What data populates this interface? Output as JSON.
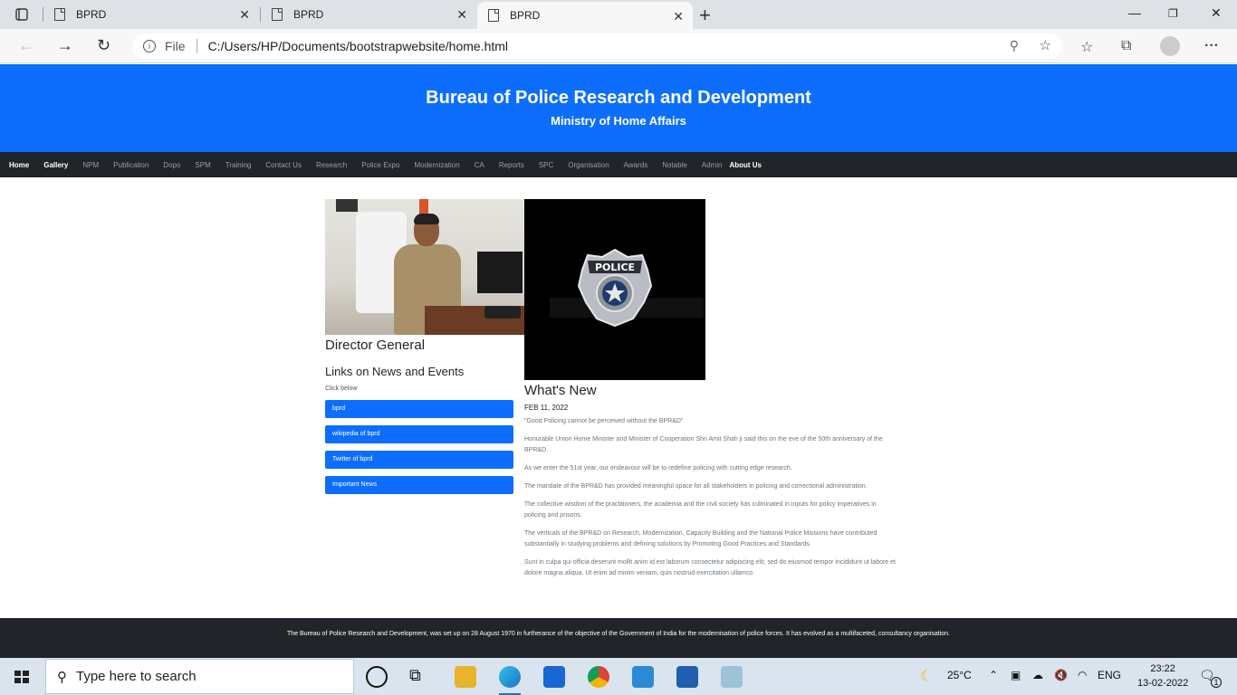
{
  "browser": {
    "tabs": [
      {
        "title": "BPRD"
      },
      {
        "title": "BPRD"
      },
      {
        "title": "BPRD"
      }
    ],
    "address": {
      "scheme_label": "File",
      "url": "C:/Users/HP/Documents/bootstrapwebsite/home.html"
    }
  },
  "site": {
    "title": "Bureau of Police Research and Development",
    "subtitle": "Ministry of Home Affairs",
    "nav": [
      "Home",
      "Gallery",
      "NPM",
      "Publication",
      "Dopo",
      "SPM",
      "Training",
      "Contact Us",
      "Research",
      "Police Expo",
      "Modernization",
      "CA",
      "Reports",
      "SPC",
      "Organisation",
      "Awards",
      "Notable",
      "Admin",
      "About Us"
    ],
    "left": {
      "role_title": "Director General",
      "links_title": "Links on News and Events",
      "click_hint": "Click below",
      "buttons": [
        "bprd",
        "wikipedia of bprd",
        "Twitter of bprd",
        "Important News"
      ]
    },
    "news": {
      "title": "What's New",
      "date": "FEB 11, 2022",
      "paragraphs": [
        "\"Good Policing cannot be perceived without the BPR&D\"",
        "Honurable Union Home Minister and Minister of Cooperation Shri Amit Shah ji said this on the eve of the 50th anniversary of the BPR&D.",
        "As we enter the 51st year, our endeavour will be to redefine policing with cutting edge research.",
        "The mandate of the BPR&D has provided meaningful space for all stakeholders in policing and correctional administration.",
        "The collective wisdom of the practitioners, the academia and the civil society has culminated in inputs for policy imperatives in policing and prisons.",
        "The verticals of the BPR&D on Research, Modernization, Capacity Building and the National Police Missions have contributed substantially in studying problems and defining solutions by Promoting Good Practices and Standards.",
        "Sunt in culpa qui officia deserunt mollit anim id est laborum consectetur adipiscing elit, sed do eiusmod tempor incididunt ut labore et dolore magna aliqua. Ut enim ad minim veniam, quis nostrud exercitation ullamco."
      ]
    },
    "badge_text": "POLICE",
    "footer_text": "The Bureau of Police Research and Development, was set up on 28 August 1970 in furtherance of the objective of the Government of India for the modernisation of police forces. It has evolved as a multifaceted, consultancy organisation."
  },
  "taskbar": {
    "search_placeholder": "Type here to search",
    "weather": "25°C",
    "language": "ENG",
    "time": "23:22",
    "date": "13-02-2022",
    "notification_count": "1"
  }
}
